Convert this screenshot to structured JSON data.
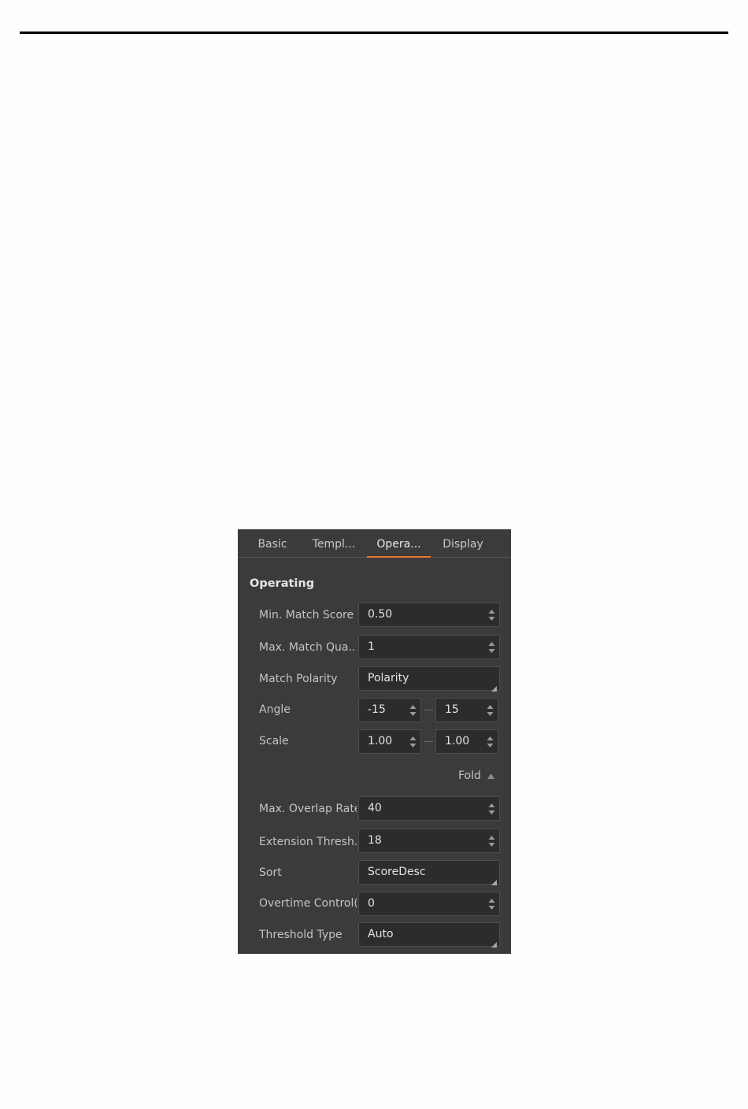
{
  "tabs": [
    "Basic",
    "Templ...",
    "Opera...",
    "Display"
  ],
  "section_title": "Operating",
  "rows": {
    "min_match_score": {
      "label": "Min. Match Score",
      "value": "0.50"
    },
    "max_match_quantity": {
      "label": "Max. Match Qua...",
      "value": "1"
    },
    "match_polarity": {
      "label": "Match Polarity",
      "value": "Polarity"
    },
    "angle": {
      "label": "Angle",
      "from": "-15",
      "to": "15"
    },
    "scale": {
      "label": "Scale",
      "from": "1.00",
      "to": "1.00"
    },
    "max_overlap_rate": {
      "label": "Max. Overlap Rate",
      "value": "40"
    },
    "extension_threshold": {
      "label": "Extension Thresh...",
      "value": "18"
    },
    "sort": {
      "label": "Sort",
      "value": "ScoreDesc"
    },
    "overtime_control": {
      "label": "Overtime Control(n",
      "value": "0"
    },
    "threshold_type": {
      "label": "Threshold Type",
      "value": "Auto"
    }
  },
  "fold_label": "Fold",
  "icons": {
    "spinner": "up-down-arrows-icon",
    "combo": "dropdown-corner-icon",
    "fold": "triangle-up-icon"
  },
  "colors": {
    "accent": "#e9772b",
    "panel_bg": "#3b3b3b",
    "field_bg": "#2c2c2c"
  }
}
